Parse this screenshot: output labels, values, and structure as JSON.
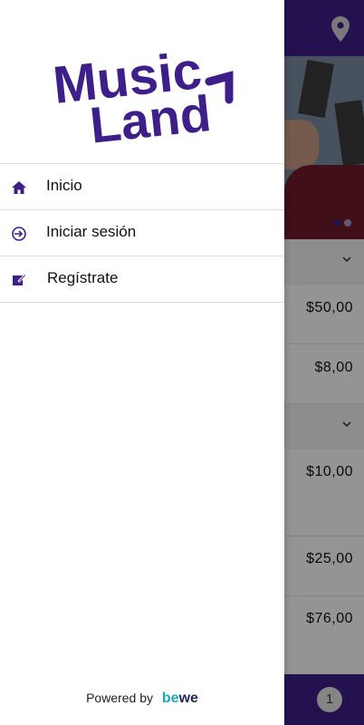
{
  "app": {
    "name": "Music Land"
  },
  "drawer": {
    "logo": {
      "line1": "Music",
      "line2": "Land"
    },
    "menu": [
      {
        "label": "Inicio",
        "icon": "home-icon"
      },
      {
        "label": "Iniciar sesión",
        "icon": "login-icon"
      },
      {
        "label": "Regístrate",
        "icon": "edit-icon"
      }
    ],
    "footer": {
      "powered_by": "Powered by",
      "brand_be": "be",
      "brand_we": "we"
    }
  },
  "background": {
    "header": {
      "icon": "location-pin-icon"
    },
    "prices": [
      "$50,00",
      "$8,00",
      "$10,00",
      "$25,00",
      "$76,00"
    ],
    "cart_count": "1"
  },
  "colors": {
    "primary": "#3e1f8a",
    "accent": "#19a9b8"
  }
}
